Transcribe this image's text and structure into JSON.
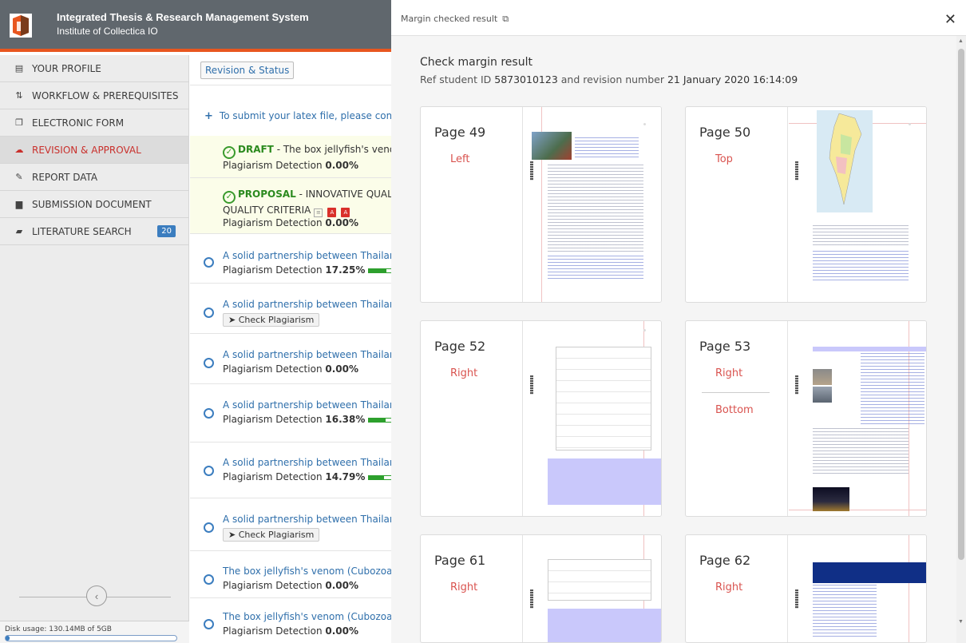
{
  "app": {
    "title": "Integrated Thesis & Research Management System",
    "subtitle": "Institute of Collectica IO"
  },
  "sidebar": {
    "items": [
      {
        "label": "YOUR PROFILE",
        "icon": "id-card-icon",
        "active": false
      },
      {
        "label": "WORKFLOW & PREREQUISITES",
        "icon": "sort-icon",
        "active": false
      },
      {
        "label": "ELECTRONIC FORM",
        "icon": "copy-icon",
        "active": false
      },
      {
        "label": "REVISION & APPROVAL",
        "icon": "cloud-upload-icon",
        "active": true
      },
      {
        "label": "REPORT DATA",
        "icon": "edit-icon",
        "active": false
      },
      {
        "label": "SUBMISSION DOCUMENT",
        "icon": "file-icon",
        "active": false
      },
      {
        "label": "LITERATURE SEARCH",
        "icon": "book-icon",
        "active": false,
        "badge": "20"
      }
    ],
    "disk_usage_label": "Disk usage: 130.14MB of 5GB",
    "disk_usage_fraction": 0.025
  },
  "middle": {
    "revision_button": "Revision & Status",
    "submit_hint": "To submit your latex file, please compre",
    "highlighted": [
      {
        "tag": "DRAFT",
        "title": " - The box jellyfish's venom",
        "plag_label": "Plagiarism Detection",
        "plag_value": "0.00%"
      },
      {
        "tag": "PROPOSAL",
        "title": " - INNOVATIVE QUALIT",
        "line2": "QUALITY CRITERIA",
        "plag_label": "Plagiarism Detection",
        "plag_value": "0.00%"
      }
    ],
    "items": [
      {
        "title": "A solid partnership between Thailand ar",
        "plag_label": "Plagiarism Detection",
        "plag_value": "17.25%",
        "plag_fraction": 0.1725,
        "check": false
      },
      {
        "title": "A solid partnership between Thailand ar",
        "check": true
      },
      {
        "title": "A solid partnership between Thailand ar",
        "plag_label": "Plagiarism Detection",
        "plag_value": "0.00%",
        "check": false
      },
      {
        "title": "A solid partnership between Thailand ar",
        "plag_label": "Plagiarism Detection",
        "plag_value": "16.38%",
        "plag_fraction": 0.1638,
        "check": false
      },
      {
        "title": "A solid partnership between Thailand ar",
        "plag_label": "Plagiarism Detection",
        "plag_value": "14.79%",
        "plag_fraction": 0.1479,
        "check": false
      },
      {
        "title": "A solid partnership between Thailand ar",
        "check": true
      },
      {
        "title": "The box jellyfish's venom (Cubozoa)",
        "plag_label": "Plagiarism Detection",
        "plag_value": "0.00%",
        "check": false
      },
      {
        "title": "The box jellyfish's venom (Cubozoa)",
        "plag_label": "Plagiarism Detection",
        "plag_value": "0.00%",
        "check": false
      }
    ],
    "check_label": "Check Plagiarism"
  },
  "panel": {
    "header": "Margin checked result",
    "title": "Check margin result",
    "ref_prefix": "Ref student ID",
    "student_id": "5873010123",
    "rev_prefix": "and revision number",
    "revision": "21 January 2020 16:14:09",
    "cards": [
      {
        "page": "Page 49",
        "sides": [
          "Left"
        ]
      },
      {
        "page": "Page 50",
        "sides": [
          "Top"
        ]
      },
      {
        "page": "Page 52",
        "sides": [
          "Right"
        ]
      },
      {
        "page": "Page 53",
        "sides": [
          "Right",
          "Bottom"
        ]
      },
      {
        "page": "Page 61",
        "sides": [
          "Right"
        ]
      },
      {
        "page": "Page 62",
        "sides": [
          "Right"
        ]
      }
    ]
  },
  "colors": {
    "header_bg": "#60676d",
    "accent": "#e8561f",
    "active_text": "#c9302c",
    "link": "#2f6fab",
    "success": "#2b8a1e",
    "margin_warning": "#d9534f"
  }
}
